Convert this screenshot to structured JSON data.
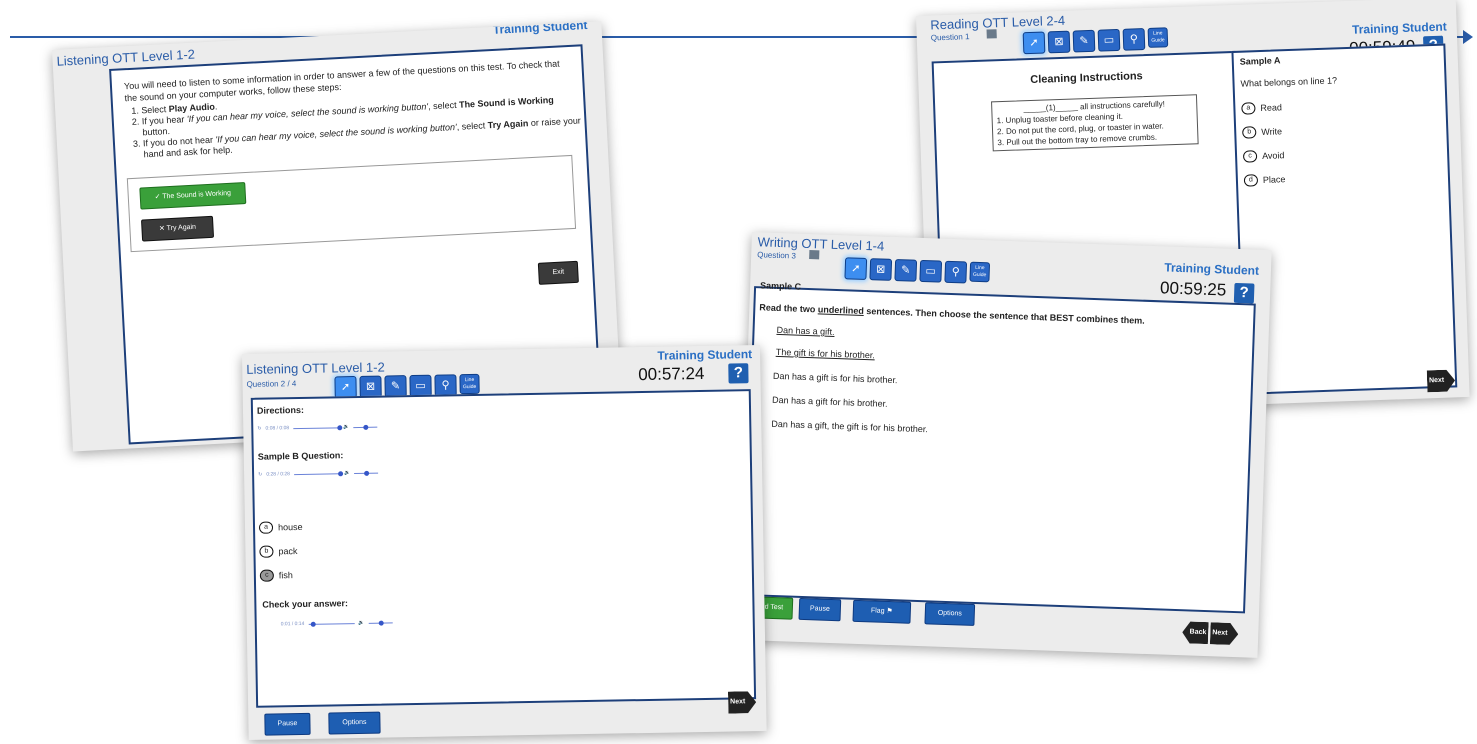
{
  "colors": {
    "accent": "#2a5ca8",
    "brand_blue": "#1e5eb2",
    "green": "#3aa03a"
  },
  "student_name": "Training Student",
  "toolbar": {
    "icons": [
      "pointer-icon",
      "eliminate-icon",
      "highlighter-icon",
      "notepad-icon",
      "magnifier-icon",
      "line-guide-icon"
    ],
    "line_guide_label": "Line Guide"
  },
  "sound_check": {
    "title": "Listening OTT Level 1-2",
    "intro": "You will need to listen to some information in order to answer a few of the questions on this test. To check that the sound on your computer works, follow these steps:",
    "step1_pre": "Select ",
    "step1_bold": "Play Audio",
    "step1_post": ".",
    "step2_pre": "If you hear ",
    "step2_ital": "'If you can hear my voice, select the sound is working button'",
    "step2_mid": ", select ",
    "step2_bold": "The Sound is Working",
    "step2_post": " button.",
    "step3_pre": "If you do not hear ",
    "step3_ital": "'If you can hear my voice, select the sound is working button'",
    "step3_mid": ", select ",
    "step3_bold": "Try Again",
    "step3_post": " or raise your hand and ask for help.",
    "sound_working_label": "The Sound is Working",
    "try_again_label": "Try Again",
    "exit_label": "Exit"
  },
  "reading": {
    "title": "Reading OTT Level 2-4",
    "question": "Question 1",
    "timer": "00:59:49",
    "passage_title": "Cleaning Instructions",
    "box_line1": "_____(1)_____ all instructions carefully!",
    "box_line2": "1. Unplug toaster before cleaning it.",
    "box_line3": "2. Do not put the cord, plug, or toaster in water.",
    "box_line4": "3. Pull out the bottom tray to remove crumbs.",
    "sample_label": "Sample A",
    "prompt": "What belongs on line 1?",
    "options": [
      {
        "letter": "a",
        "text": "Read"
      },
      {
        "letter": "b",
        "text": "Write"
      },
      {
        "letter": "c",
        "text": "Avoid"
      },
      {
        "letter": "d",
        "text": "Place"
      }
    ],
    "next_label": "Next"
  },
  "writing": {
    "title": "Writing OTT Level 1-4",
    "question": "Question 3",
    "timer": "00:59:25",
    "sample_label": "Sample C",
    "instr_pre": "Read the two ",
    "instr_underlined": "underlined",
    "instr_post": " sentences. Then choose the sentence that BEST combines them.",
    "sentence1": "Dan has a gift.",
    "sentence2": "The gift is for his brother.",
    "options": [
      "Dan has a gift is for his brother.",
      "Dan has a gift for his brother.",
      "Dan has a gift, the gift is for his brother."
    ],
    "end_test_label": "d Test",
    "pause_label": "Pause",
    "flag_label": "Flag",
    "options_label": "Options",
    "back_label": "Back",
    "next_label": "Next"
  },
  "listening": {
    "title": "Listening OTT Level 1-2",
    "question": "Question 2 / 4",
    "timer": "00:57:24",
    "directions_label": "Directions:",
    "directions_time": "0:08 / 0:08",
    "sample_label": "Sample B Question:",
    "sample_time": "0:28 / 0:28",
    "options": [
      {
        "letter": "a",
        "text": "house"
      },
      {
        "letter": "b",
        "text": "pack"
      },
      {
        "letter": "c",
        "text": "fish"
      }
    ],
    "check_label": "Check your answer:",
    "check_time": "0:01 / 0:14",
    "pause_label": "Pause",
    "options_label": "Options",
    "next_label": "Next"
  }
}
